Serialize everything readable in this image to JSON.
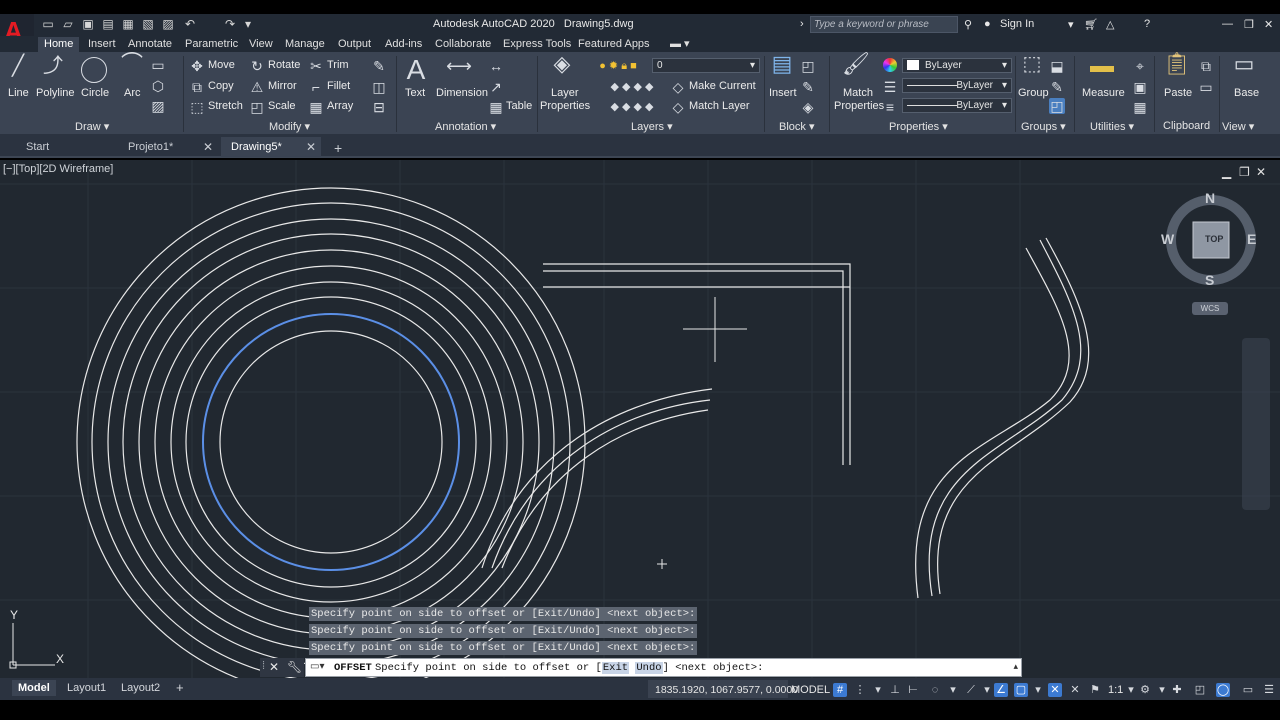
{
  "window": {
    "title": "Autodesk AutoCAD 2020",
    "file": "Drawing5.dwg",
    "search_placeholder": "Type a keyword or phrase",
    "sign_in": "Sign In"
  },
  "ribbon_tabs": [
    "Home",
    "Insert",
    "Annotate",
    "Parametric",
    "View",
    "Manage",
    "Output",
    "Add-ins",
    "Collaborate",
    "Express Tools",
    "Featured Apps"
  ],
  "draw_panel": {
    "title": "Draw",
    "line": "Line",
    "polyline": "Polyline",
    "circle": "Circle",
    "arc": "Arc"
  },
  "modify_panel": {
    "title": "Modify",
    "move": "Move",
    "rotate": "Rotate",
    "trim": "Trim",
    "copy": "Copy",
    "mirror": "Mirror",
    "fillet": "Fillet",
    "stretch": "Stretch",
    "scale": "Scale",
    "array": "Array"
  },
  "annotation_panel": {
    "title": "Annotation",
    "text": "Text",
    "dimension": "Dimension",
    "table": "Table"
  },
  "layers_panel": {
    "title": "Layers",
    "layer_properties_1": "Layer",
    "layer_properties_2": "Properties",
    "current_layer": "0",
    "make_current": "Make Current",
    "match_layer": "Match Layer"
  },
  "block_panel": {
    "title": "Block",
    "insert": "Insert"
  },
  "properties_panel": {
    "title": "Properties",
    "match_1": "Match",
    "match_2": "Properties",
    "color": "ByLayer",
    "linetype": "ByLayer",
    "lineweight": "ByLayer"
  },
  "groups_panel": {
    "title": "Groups",
    "group": "Group"
  },
  "utilities_panel": {
    "title": "Utilities",
    "measure": "Measure"
  },
  "clipboard_panel": {
    "title": "Clipboard",
    "paste": "Paste"
  },
  "view_panel": {
    "title": "View",
    "base": "Base"
  },
  "file_tabs": [
    "Start",
    "Projeto1*",
    "Drawing5*"
  ],
  "viewport": {
    "label": "[−][Top][2D Wireframe]",
    "compass": {
      "n": "N",
      "s": "S",
      "e": "E",
      "w": "W",
      "top": "TOP"
    },
    "wcs": "WCS",
    "ucs_x": "X",
    "ucs_y": "Y"
  },
  "command": {
    "history": [
      "Specify point on side to offset or [Exit/Undo] <next object>:",
      "Specify point on side to offset or [Exit/Undo] <next object>:",
      "Specify point on side to offset or [Exit/Undo] <next object>:"
    ],
    "name": "OFFSET",
    "prompt_pre": "Specify point on side to offset or [",
    "opt_exit": "Exit",
    "opt_undo": "Undo",
    "prompt_post": "] <next object>:"
  },
  "status": {
    "layouts": [
      "Model",
      "Layout1",
      "Layout2"
    ],
    "coords": "1835.1920, 1067.9577, 0.0000",
    "model": "MODEL",
    "scale": "1:1"
  },
  "colors": {
    "accent": "#3c7ad1",
    "selected_circle": "#5b8fe6",
    "geometry": "#e8e8e8",
    "viewport_bg": "#212830"
  }
}
